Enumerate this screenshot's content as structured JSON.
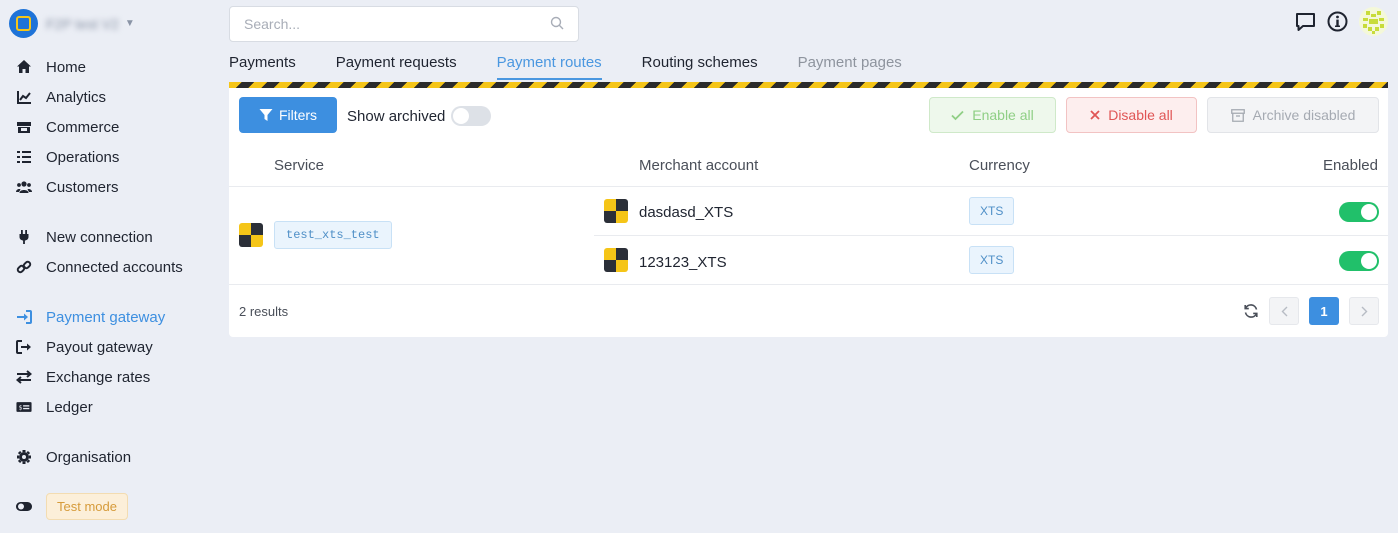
{
  "brand": {
    "name": "F2P test V2"
  },
  "nav": {
    "home": "Home",
    "analytics": "Analytics",
    "commerce": "Commerce",
    "operations": "Operations",
    "customers": "Customers",
    "new_connection": "New connection",
    "connected_accounts": "Connected accounts",
    "payment_gateway": "Payment gateway",
    "payout_gateway": "Payout gateway",
    "exchange_rates": "Exchange rates",
    "ledger": "Ledger",
    "organisation": "Organisation",
    "test_mode": "Test mode"
  },
  "search": {
    "placeholder": "Search..."
  },
  "tabs": {
    "payments": "Payments",
    "payment_requests": "Payment requests",
    "payment_routes": "Payment routes",
    "routing_schemes": "Routing schemes",
    "payment_pages": "Payment pages"
  },
  "toolbar": {
    "filters": "Filters",
    "show_archived": "Show archived",
    "enable_all": "Enable all",
    "disable_all": "Disable all",
    "archive_disabled": "Archive disabled"
  },
  "table": {
    "headers": {
      "service": "Service",
      "merchant": "Merchant account",
      "currency": "Currency",
      "enabled": "Enabled"
    },
    "service": "test_xts_test",
    "rows": [
      {
        "merchant": "dasdasd_XTS",
        "currency": "XTS",
        "enabled": true
      },
      {
        "merchant": "123123_XTS",
        "currency": "XTS",
        "enabled": true
      }
    ]
  },
  "footer": {
    "results": "2 results",
    "page": "1"
  },
  "colors": {
    "accent": "#3d8fe0",
    "success": "#21c06a",
    "danger": "#e05555",
    "hazard_yellow": "#f5c518"
  }
}
